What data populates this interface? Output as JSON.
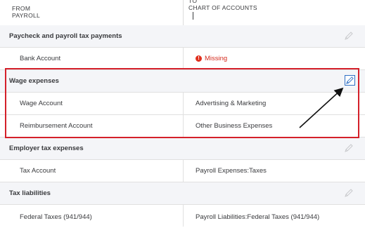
{
  "header": {
    "from_label": "FROM",
    "from_sub": "PAYROLL",
    "to_label": "TO",
    "to_sub": "CHART OF ACCOUNTS"
  },
  "sections": {
    "paycheck": {
      "title": "Paycheck and payroll tax payments",
      "row_label": "Bank Account",
      "row_value": "Missing"
    },
    "wage": {
      "title": "Wage expenses",
      "rows": [
        {
          "label": "Wage Account",
          "value": "Advertising & Marketing"
        },
        {
          "label": "Reimbursement Account",
          "value": "Other Business Expenses"
        }
      ]
    },
    "employer": {
      "title": "Employer tax expenses",
      "row_label": "Tax Account",
      "row_value": "Payroll Expenses:Taxes"
    },
    "liabilities": {
      "title": "Tax liabilities",
      "row_label": "Federal Taxes (941/944)",
      "row_value": "Payroll Liabilities:Federal Taxes (941/944)"
    }
  },
  "colors": {
    "highlight": "#d4202a",
    "missing": "#d52b1e",
    "section_bg": "#f4f5f8",
    "edit_box": "#2f6fc4"
  },
  "icons": {
    "edit": "pencil-icon",
    "missing": "warning-icon"
  }
}
